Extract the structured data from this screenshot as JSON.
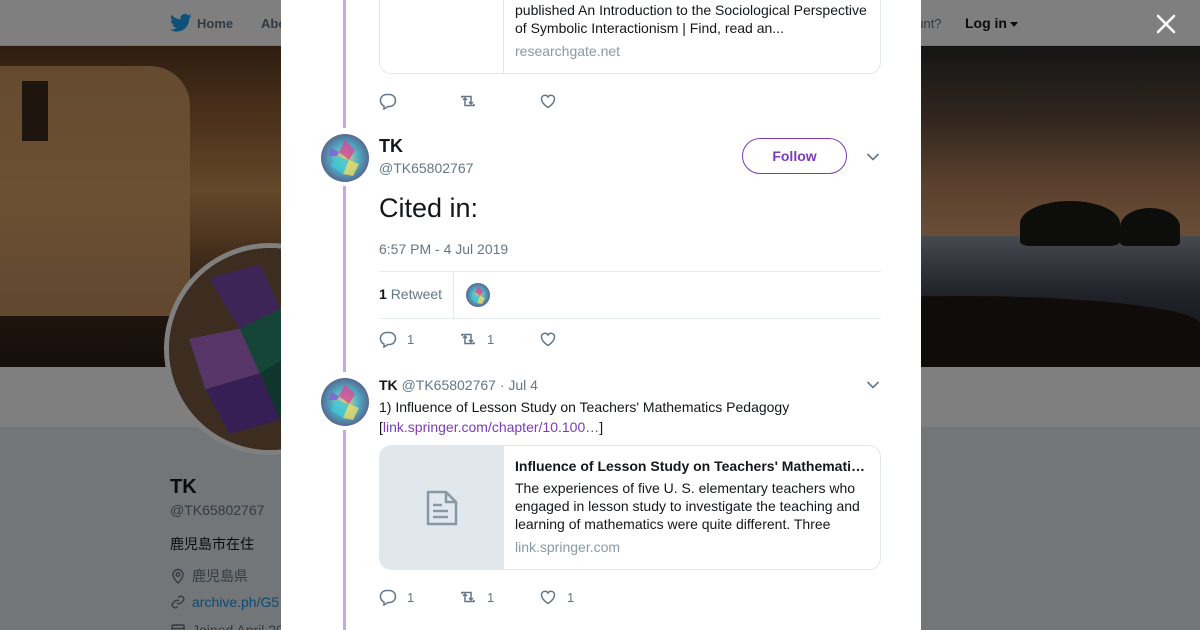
{
  "nav": {
    "home_label": "Home",
    "about_label": "Abo",
    "have_account": "ccount?",
    "login_label": "Log in"
  },
  "profile": {
    "name": "TK",
    "handle": "@TK65802767",
    "bio": "鹿児島市在住",
    "location": "鹿児島県",
    "link": "archive.ph/G5",
    "joined": "Joined April 20"
  },
  "tweet_top": {
    "card_desc": "published An Introduction to the Sociological Perspective of Symbolic Interactionism | Find, read an...",
    "card_domain": "researchgate.net"
  },
  "tweet_main": {
    "name": "TK",
    "handle": "@TK65802767",
    "follow_label": "Follow",
    "text": "Cited in:",
    "time": "6:57 PM - 4 Jul 2019",
    "retweet_count": "1",
    "retweet_label": "Retweet",
    "reply_count": "1",
    "retweets": "1"
  },
  "tweet_reply": {
    "name": "TK",
    "handle": "@TK65802767",
    "date": "· Jul 4",
    "text_prefix": "1) Influence of Lesson Study on Teachers' Mathematics Pedagogy [",
    "link_text": "link.springer.com/chapter/10.100…",
    "text_suffix": "]",
    "card_title": "Influence of Lesson Study on Teachers' Mathematics Pedagogy",
    "card_desc": "The experiences of five U. S. elementary teachers who engaged in lesson study to investigate the teaching and learning of mathematics were quite different. Three teachers...",
    "card_domain": "link.springer.com",
    "reply_count": "1",
    "retweet_count": "1",
    "like_count": "1"
  },
  "colors": {
    "accent": "#7b3bb7",
    "thread_line": "#c9a6e6",
    "twitter_blue": "#1da1f2"
  }
}
